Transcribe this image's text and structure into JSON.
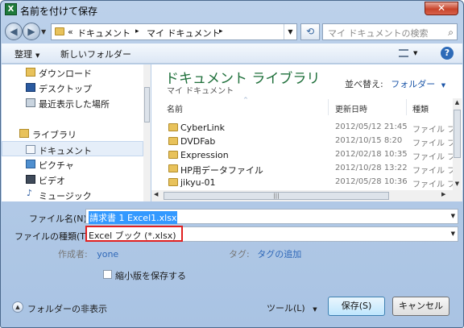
{
  "window": {
    "title": "名前を付けて保存",
    "app_icon": "X",
    "close": "✕"
  },
  "address": {
    "prefix": "«",
    "crumbs": [
      "ドキュメント",
      "マイ ドキュメント"
    ],
    "separator": "▸",
    "search_placeholder": "マイ ドキュメントの検索"
  },
  "toolbar": {
    "organize": "整理",
    "new_folder": "新しいフォルダー",
    "help": "?"
  },
  "nav": {
    "items": [
      {
        "label": "ダウンロード",
        "icon": "download-folder-icon"
      },
      {
        "label": "デスクトップ",
        "icon": "desktop-icon"
      },
      {
        "label": "最近表示した場所",
        "icon": "recent-places-icon"
      },
      {
        "label": "ライブラリ",
        "icon": "libraries-icon"
      },
      {
        "label": "ドキュメント",
        "icon": "documents-icon"
      },
      {
        "label": "ピクチャ",
        "icon": "pictures-icon"
      },
      {
        "label": "ビデオ",
        "icon": "videos-icon"
      },
      {
        "label": "ミュージック",
        "icon": "music-icon"
      }
    ]
  },
  "library": {
    "title": "ドキュメント ライブラリ",
    "subtitle": "マイ ドキュメント",
    "sort_label": "並べ替え:",
    "sort_value": "フォルダー"
  },
  "columns": {
    "name": "名前",
    "date": "更新日時",
    "type": "種類"
  },
  "files": [
    {
      "name": "CyberLink",
      "date": "2012/05/12 21:45",
      "type": "ファイル フ"
    },
    {
      "name": "DVDFab",
      "date": "2012/10/15 8:20",
      "type": "ファイル フ"
    },
    {
      "name": "Expression",
      "date": "2012/02/18 10:35",
      "type": "ファイル フ"
    },
    {
      "name": "HP用データファイル",
      "date": "2012/10/28 13:22",
      "type": "ファイル フ"
    },
    {
      "name": "jikyu-01",
      "date": "2012/05/28 10:36",
      "type": "ファイル フ"
    }
  ],
  "form": {
    "filename_label": "ファイル名(N):",
    "filename_value": "請求書 1 Excel1.xlsx",
    "filetype_label": "ファイルの種類(T):",
    "filetype_value": "Excel ブック (*.xlsx)",
    "author_label": "作成者:",
    "author_value": "yone",
    "tags_label": "タグ:",
    "tags_value": "タグの追加",
    "thumbnail_label": "縮小版を保存する"
  },
  "footer": {
    "hide_folders": "フォルダーの非表示",
    "tools": "ツール(L)",
    "save": "保存(S)",
    "cancel": "キャンセル"
  },
  "colors": {
    "accent": "#1e6f3a",
    "link": "#2f68b8",
    "highlight_box": "#e02020",
    "selection": "#3399ff"
  }
}
